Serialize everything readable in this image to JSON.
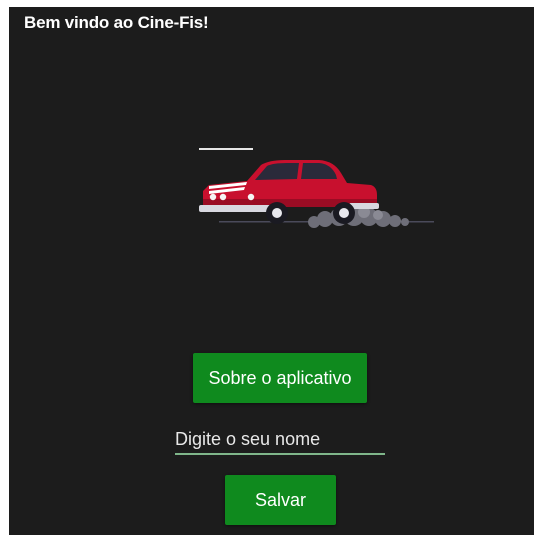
{
  "app": {
    "title": "Bem vindo ao Cine-Fis!"
  },
  "illustration": {
    "icon": "red-car-icon",
    "car_color": "#c8102e",
    "smoke_color": "#6e6e78"
  },
  "buttons": {
    "about_label": "Sobre o aplicativo",
    "save_label": "Salvar",
    "color": "#0f8a1e"
  },
  "name_input": {
    "placeholder": "Digite o seu nome",
    "value": ""
  },
  "colors": {
    "background": "#1c1c1c",
    "input_underline": "#7fb68a"
  }
}
